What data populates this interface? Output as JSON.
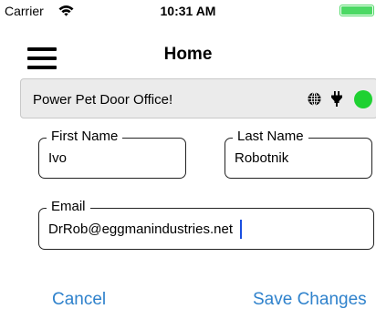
{
  "status_bar": {
    "carrier": "Carrier",
    "time": "10:31 AM",
    "battery_level": 1.0,
    "battery_color": "#4cd964"
  },
  "nav": {
    "title": "Home",
    "menu_icon": "hamburger-menu-icon"
  },
  "device": {
    "name": "Power Pet Door Office!",
    "icons": [
      "globe-icon",
      "plug-icon"
    ],
    "status_color": "#1fd132"
  },
  "form": {
    "first_name": {
      "label": "First Name",
      "value": "Ivo"
    },
    "last_name": {
      "label": "Last Name",
      "value": "Robotnik"
    },
    "email": {
      "label": "Email",
      "value": "DrRob@eggmanindustries.net"
    }
  },
  "actions": {
    "cancel_label": "Cancel",
    "save_label": "Save Changes",
    "accent_color": "#2f82cc"
  }
}
